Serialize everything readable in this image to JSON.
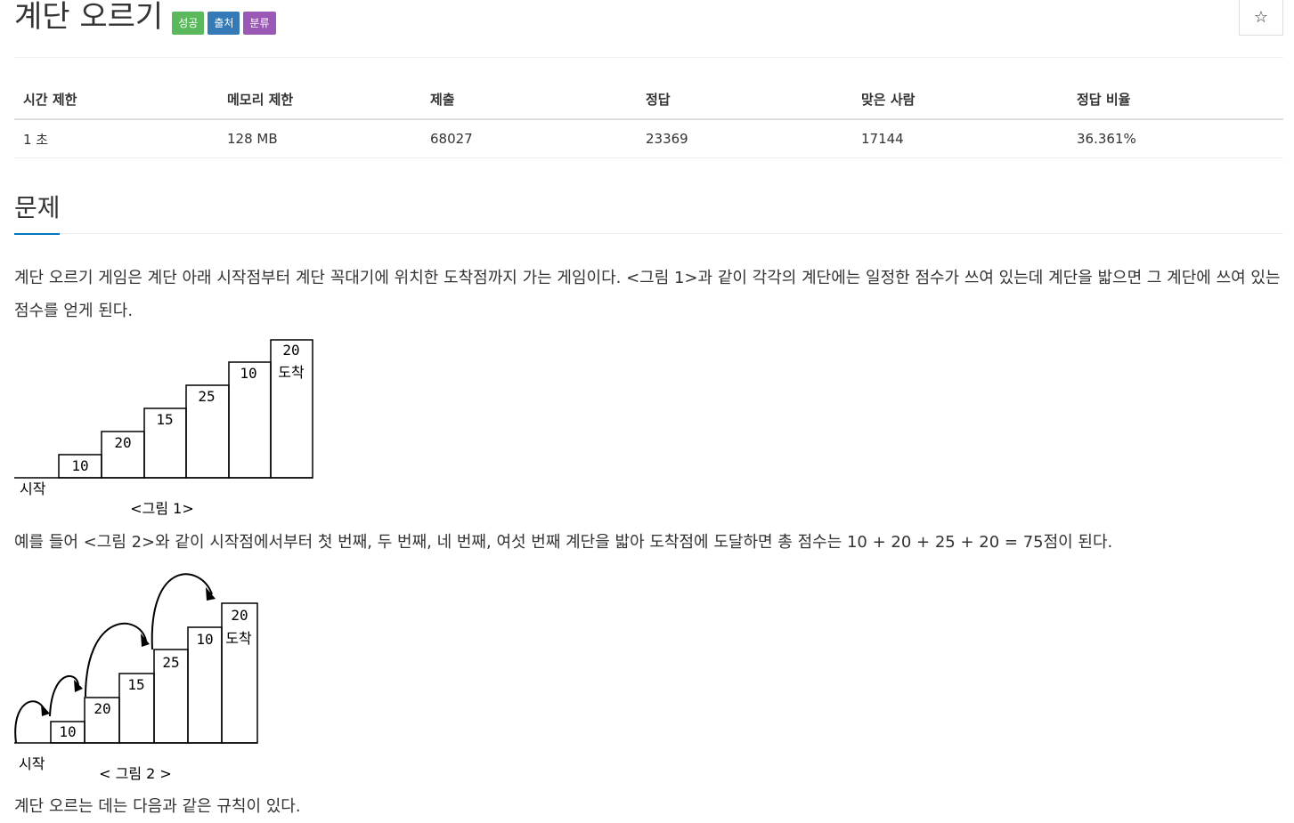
{
  "header": {
    "title": "계단 오르기",
    "badges": [
      {
        "label": "성공",
        "color": "#5cb85c"
      },
      {
        "label": "출처",
        "color": "#337ab7"
      },
      {
        "label": "분류",
        "color": "#9b59b6"
      }
    ],
    "star_icon": "☆"
  },
  "info_table": {
    "headers": [
      "시간 제한",
      "메모리 제한",
      "제출",
      "정답",
      "맞은 사람",
      "정답 비율"
    ],
    "row": [
      "1 초",
      "128 MB",
      "68027",
      "23369",
      "17144",
      "36.361%"
    ]
  },
  "section": {
    "title": "문제"
  },
  "problem": {
    "para1": "계단 오르기 게임은 계단 아래 시작점부터 계단 꼭대기에 위치한 도착점까지 가는 게임이다. <그림 1>과 같이 각각의 계단에는 일정한 점수가 쓰여 있는데 계단을 밟으면 그 계단에 쓰여 있는 점수를 얻게 된다.",
    "para2": "예를 들어 <그림 2>와 같이 시작점에서부터 첫 번째, 두 번째, 네 번째, 여섯 번째 계단을 밟아 도착점에 도달하면 총 점수는 10 + 20 + 25 + 20 = 75점이 된다.",
    "para3": "계단 오르는 데는 다음과 같은 규칙이 있다."
  },
  "figure1": {
    "steps": [
      "10",
      "20",
      "15",
      "25",
      "10",
      "20"
    ],
    "start_label": "시작",
    "end_label": "도착",
    "caption": "<그림 1>"
  },
  "figure2": {
    "steps": [
      "10",
      "20",
      "15",
      "25",
      "10",
      "20"
    ],
    "start_label": "시작",
    "end_label": "도착",
    "caption": "< 그림 2 >"
  }
}
